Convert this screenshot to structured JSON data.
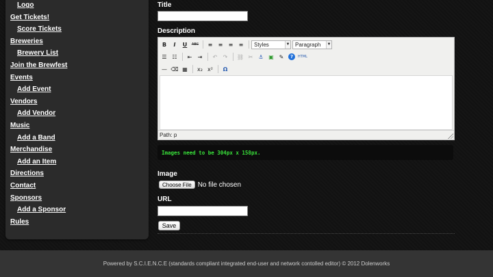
{
  "sidebar": {
    "items": [
      {
        "label": "Logo",
        "sub": true
      },
      {
        "label": "Get Tickets!",
        "sub": false
      },
      {
        "label": "Score Tickets",
        "sub": true
      },
      {
        "label": "Breweries",
        "sub": false
      },
      {
        "label": "Brewery List",
        "sub": true
      },
      {
        "label": "Join the Brewfest",
        "sub": false
      },
      {
        "label": "Events",
        "sub": false
      },
      {
        "label": "Add Event",
        "sub": true
      },
      {
        "label": "Vendors",
        "sub": false
      },
      {
        "label": "Add Vendor",
        "sub": true
      },
      {
        "label": "Music",
        "sub": false
      },
      {
        "label": "Add a Band",
        "sub": true
      },
      {
        "label": "Merchandise",
        "sub": false
      },
      {
        "label": "Add an Item",
        "sub": true
      },
      {
        "label": "Directions",
        "sub": false
      },
      {
        "label": "Contact",
        "sub": false
      },
      {
        "label": "Sponsors",
        "sub": false
      },
      {
        "label": "Add a Sponsor",
        "sub": true
      },
      {
        "label": "Rules",
        "sub": false
      }
    ]
  },
  "form": {
    "title_label": "Title",
    "title_value": "",
    "description_label": "Description",
    "image_label": "Image",
    "choose_file_label": "Choose File",
    "file_status": "No file chosen",
    "url_label": "URL",
    "url_value": "",
    "save_label": "Save",
    "image_notice": "Images need to be 304px x 158px."
  },
  "editor": {
    "styles_select": "Styles",
    "format_select": "Paragraph",
    "path_text": "Path: p",
    "toolbar_row1": [
      {
        "name": "bold-icon",
        "glyph": "B"
      },
      {
        "name": "italic-icon",
        "glyph": "I"
      },
      {
        "name": "underline-icon",
        "glyph": "U"
      },
      {
        "name": "strikethrough-icon",
        "glyph": "ABC"
      },
      {
        "name": "align-left-icon",
        "glyph": "≡"
      },
      {
        "name": "align-center-icon",
        "glyph": "≡"
      },
      {
        "name": "align-right-icon",
        "glyph": "≡"
      },
      {
        "name": "align-justify-icon",
        "glyph": "≡"
      }
    ],
    "toolbar_row2": [
      {
        "name": "bullet-list-icon",
        "glyph": "☰"
      },
      {
        "name": "numbered-list-icon",
        "glyph": "☷"
      },
      {
        "name": "outdent-icon",
        "glyph": "⇤"
      },
      {
        "name": "indent-icon",
        "glyph": "⇥"
      },
      {
        "name": "undo-icon",
        "glyph": "↶"
      },
      {
        "name": "redo-icon",
        "glyph": "↷"
      },
      {
        "name": "link-icon",
        "glyph": "⛓"
      },
      {
        "name": "unlink-icon",
        "glyph": "✂"
      },
      {
        "name": "anchor-icon",
        "glyph": "⚓"
      },
      {
        "name": "image-icon",
        "glyph": "▣"
      },
      {
        "name": "cleanup-icon",
        "glyph": "✎"
      },
      {
        "name": "help-icon",
        "glyph": "?"
      },
      {
        "name": "html-icon",
        "glyph": "HTML"
      }
    ],
    "toolbar_row3": [
      {
        "name": "horizontal-rule-icon",
        "glyph": "—"
      },
      {
        "name": "remove-format-icon",
        "glyph": "⌫"
      },
      {
        "name": "visual-aid-icon",
        "glyph": "▦"
      },
      {
        "name": "subscript-icon",
        "glyph": "x₂"
      },
      {
        "name": "superscript-icon",
        "glyph": "x²"
      },
      {
        "name": "special-char-icon",
        "glyph": "Ω"
      }
    ]
  },
  "footer": {
    "text": "Powered by S.C.I.E.N.C.E (standards compliant integrated end-user and network contolled editor) © 2012 Dolenworks"
  },
  "colors": {
    "notice_text": "#39e03a",
    "help_icon": "#1e6fd9",
    "image_icon": "#2e9a2e",
    "anchor_icon": "#2b5cb8"
  }
}
